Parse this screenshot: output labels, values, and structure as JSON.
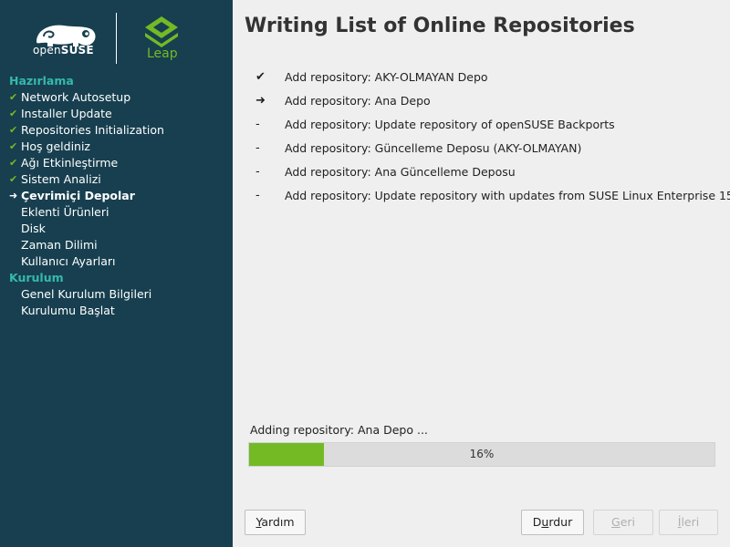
{
  "sidebar": {
    "brand": {
      "opensuse_prefix": "open",
      "opensuse_suffix": "SUSE",
      "leap": "Leap"
    },
    "sections": [
      {
        "title": "Hazırlama",
        "steps": [
          {
            "label": "Network Autosetup",
            "status": "done"
          },
          {
            "label": "Installer Update",
            "status": "done"
          },
          {
            "label": "Repositories Initialization",
            "status": "done"
          },
          {
            "label": "Hoş geldiniz",
            "status": "done"
          },
          {
            "label": "Ağı Etkinleştirme",
            "status": "done"
          },
          {
            "label": "Sistem Analizi",
            "status": "done"
          },
          {
            "label": "Çevrimiçi Depolar",
            "status": "current"
          },
          {
            "label": "Eklenti Ürünleri",
            "status": "pending"
          },
          {
            "label": "Disk",
            "status": "pending"
          },
          {
            "label": "Zaman Dilimi",
            "status": "pending"
          },
          {
            "label": "Kullanıcı Ayarları",
            "status": "pending"
          }
        ]
      },
      {
        "title": "Kurulum",
        "steps": [
          {
            "label": "Genel Kurulum Bilgileri",
            "status": "pending"
          },
          {
            "label": "Kurulumu Başlat",
            "status": "pending"
          }
        ]
      }
    ]
  },
  "main": {
    "title": "Writing List of Online Repositories",
    "repositories": [
      {
        "status_glyph": "✔",
        "label": "Add repository: AKY-OLMAYAN Depo"
      },
      {
        "status_glyph": "➜",
        "label": "Add repository: Ana Depo"
      },
      {
        "status_glyph": "-",
        "label": "Add repository: Update repository of openSUSE Backports"
      },
      {
        "status_glyph": "-",
        "label": "Add repository: Güncelleme Deposu (AKY-OLMAYAN)"
      },
      {
        "status_glyph": "-",
        "label": "Add repository: Ana Güncelleme Deposu"
      },
      {
        "status_glyph": "-",
        "label": "Add repository: Update repository with updates from SUSE Linux Enterprise 15"
      }
    ],
    "progress": {
      "label": "Adding repository: Ana Depo ...",
      "percent": 16,
      "text": "16%"
    }
  },
  "buttons": {
    "help": {
      "before": "",
      "mnemonic": "Y",
      "after": "ardım",
      "enabled": true
    },
    "abort": {
      "before": "D",
      "mnemonic": "u",
      "after": "rdur",
      "enabled": true
    },
    "back": {
      "before": "",
      "mnemonic": "G",
      "after": "eri",
      "enabled": false
    },
    "next": {
      "before": "",
      "mnemonic": "İ",
      "after": "leri",
      "enabled": false
    }
  },
  "colors": {
    "sidebar_bg": "#173f4f",
    "accent_green": "#73ba25",
    "section_teal": "#35b9ab",
    "page_bg": "#efefef"
  },
  "icons": {
    "done": "check-icon",
    "current": "arrow-right-icon"
  }
}
